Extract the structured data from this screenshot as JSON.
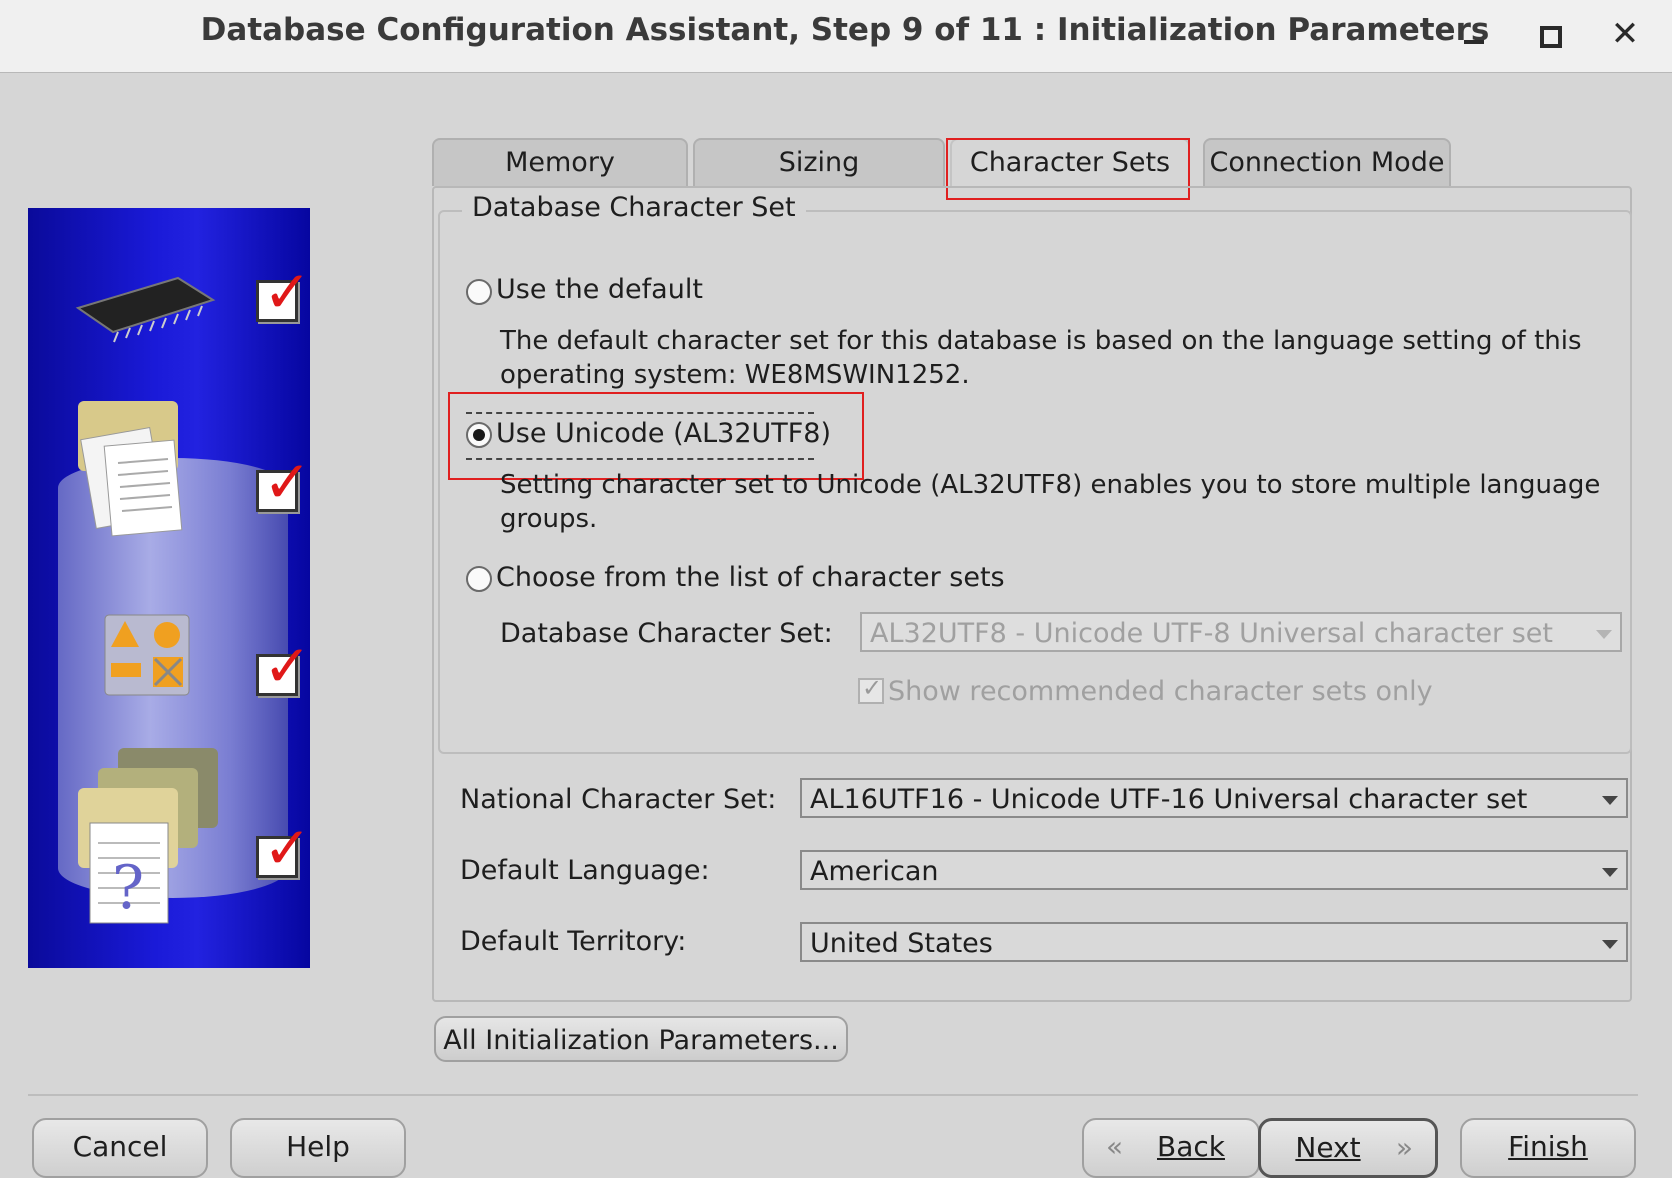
{
  "window": {
    "title": "Database Configuration Assistant, Step 9 of 11 : Initialization Parameters",
    "controls": [
      "minimize",
      "maximize",
      "close"
    ]
  },
  "tabs": [
    {
      "label": "Memory",
      "active": false
    },
    {
      "label": "Sizing",
      "active": false
    },
    {
      "label": "Character Sets",
      "active": true
    },
    {
      "label": "Connection Mode",
      "active": false
    }
  ],
  "charset_group": {
    "legend": "Database Character Set",
    "options": [
      {
        "label": "Use the default",
        "selected": false,
        "description": "The default character set for this database is based on the language setting of this operating system: WE8MSWIN1252."
      },
      {
        "label": "Use Unicode (AL32UTF8)",
        "selected": true,
        "description": "Setting character set to Unicode (AL32UTF8) enables you to store multiple language groups."
      },
      {
        "label": "Choose from the list of character sets",
        "selected": false
      }
    ],
    "db_charset_label": "Database Character Set:",
    "db_charset_value": "AL32UTF8 - Unicode UTF-8 Universal character set",
    "show_recommended_label": "Show recommended character sets only",
    "show_recommended_checked": true
  },
  "fields": {
    "national_label": "National Character Set:",
    "national_value": "AL16UTF16 - Unicode UTF-16 Universal character set",
    "language_label": "Default Language:",
    "language_value": "American",
    "territory_label": "Default Territory:",
    "territory_value": "United States"
  },
  "all_params_button": "All Initialization Parameters...",
  "buttons": {
    "cancel": "Cancel",
    "help": "Help",
    "back": "Back",
    "next": "Next",
    "finish": "Finish"
  },
  "colors": {
    "highlight": "#e02020",
    "sidebar_blue": "#1a1ad8",
    "check_red": "#e01818"
  }
}
